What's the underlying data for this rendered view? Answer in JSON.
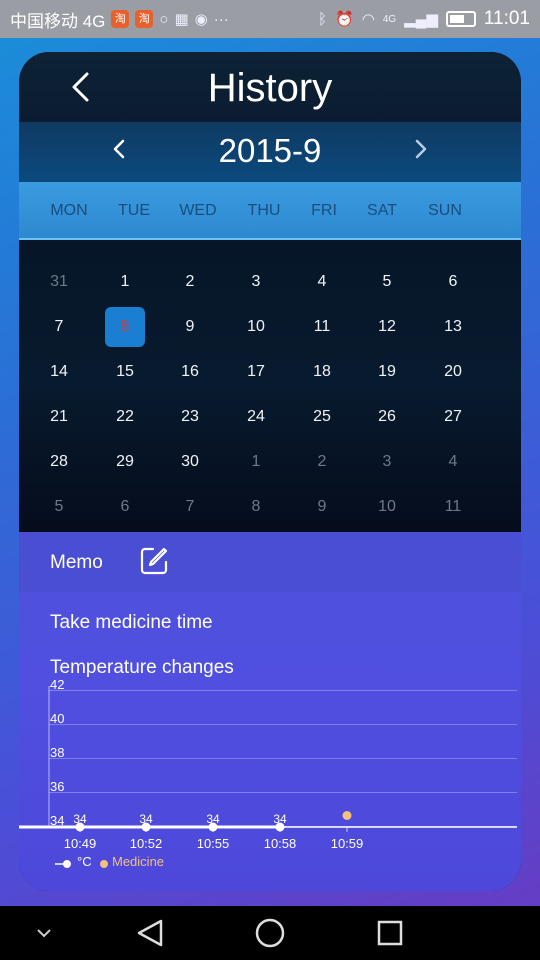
{
  "statusbar": {
    "carrier": "中国移动 4G",
    "app_badges": [
      "淘",
      "淘"
    ],
    "network": "4G",
    "time": "11:01"
  },
  "header": {
    "title": "History",
    "back_icon": "chevron-left-icon"
  },
  "calendar": {
    "month_label": "2015-9",
    "weekdays": [
      "MON",
      "TUE",
      "WED",
      "THU",
      "FRI",
      "SAT",
      "SUN"
    ],
    "weeks": [
      [
        {
          "d": "31",
          "muted": true
        },
        {
          "d": "1"
        },
        {
          "d": "2"
        },
        {
          "d": "3"
        },
        {
          "d": "4"
        },
        {
          "d": "5"
        },
        {
          "d": "6"
        }
      ],
      [
        {
          "d": "7"
        },
        {
          "d": "8",
          "selected": true
        },
        {
          "d": "9"
        },
        {
          "d": "10"
        },
        {
          "d": "11"
        },
        {
          "d": "12"
        },
        {
          "d": "13"
        }
      ],
      [
        {
          "d": "14"
        },
        {
          "d": "15"
        },
        {
          "d": "16"
        },
        {
          "d": "17"
        },
        {
          "d": "18"
        },
        {
          "d": "19"
        },
        {
          "d": "20"
        }
      ],
      [
        {
          "d": "21"
        },
        {
          "d": "22"
        },
        {
          "d": "23"
        },
        {
          "d": "24"
        },
        {
          "d": "25"
        },
        {
          "d": "26"
        },
        {
          "d": "27"
        }
      ],
      [
        {
          "d": "28"
        },
        {
          "d": "29"
        },
        {
          "d": "30"
        },
        {
          "d": "1",
          "muted": true
        },
        {
          "d": "2",
          "muted": true
        },
        {
          "d": "3",
          "muted": true
        },
        {
          "d": "4",
          "muted": true
        }
      ],
      [
        {
          "d": "5",
          "muted": true
        },
        {
          "d": "6",
          "muted": true
        },
        {
          "d": "7",
          "muted": true
        },
        {
          "d": "8",
          "muted": true
        },
        {
          "d": "9",
          "muted": true
        },
        {
          "d": "10",
          "muted": true
        },
        {
          "d": "11",
          "muted": true
        }
      ]
    ],
    "selected_color": "#1a7fd0"
  },
  "memo": {
    "label": "Memo",
    "edit_icon": "edit-icon"
  },
  "medicine": {
    "label": "Take medicine time"
  },
  "temperature": {
    "label": "Temperature changes"
  },
  "chart_data": {
    "type": "line",
    "x": [
      "10:49",
      "10:52",
      "10:55",
      "10:58",
      "10:59"
    ],
    "series": [
      {
        "name": "°C",
        "values": [
          34,
          34,
          34,
          34,
          null
        ],
        "color": "#ffffff"
      },
      {
        "name": "Medicine",
        "values": [
          null,
          null,
          null,
          null,
          34.5
        ],
        "color": "#f4c27a"
      }
    ],
    "data_labels": [
      "34",
      "34",
      "34",
      "34"
    ],
    "yticks": [
      "34",
      "36",
      "38",
      "40",
      "42"
    ],
    "ylim": [
      34,
      42
    ],
    "grid": true,
    "legend": "bottom-left"
  }
}
